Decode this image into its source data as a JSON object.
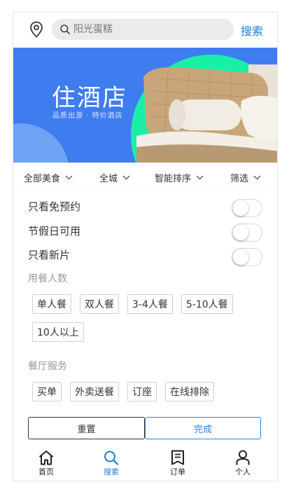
{
  "header": {
    "location_icon": "location-pin-icon",
    "search_placeholder": "阳光蛋糕",
    "search_button": "搜索"
  },
  "banner": {
    "title": "住酒店",
    "subtitle": "品质出游 · 特价酒店",
    "colors": {
      "background": "#3f7cf0",
      "accent": "#19f0a6"
    }
  },
  "filters": [
    {
      "label": "全部美食"
    },
    {
      "label": "全城"
    },
    {
      "label": "智能排序"
    },
    {
      "label": "筛选"
    }
  ],
  "panel": {
    "toggles": [
      {
        "label": "只看免预约",
        "on": false
      },
      {
        "label": "节假日可用",
        "on": false
      },
      {
        "label": "只看新片",
        "on": false
      }
    ],
    "diners_title": "用餐人数",
    "diners": [
      "单人餐",
      "双人餐",
      "3-4人餐",
      "5-10人餐",
      "10人以上"
    ],
    "services_title": "餐厅服务",
    "services": [
      "买单",
      "外卖送餐",
      "订座",
      "在线排除"
    ],
    "reset_label": "重置",
    "done_label": "完成"
  },
  "tabbar": {
    "items": [
      {
        "label": "首页",
        "icon": "home-icon"
      },
      {
        "label": "搜索",
        "icon": "search-icon",
        "active": true
      },
      {
        "label": "订单",
        "icon": "order-icon"
      },
      {
        "label": "个人",
        "icon": "profile-icon"
      }
    ],
    "active_color": "#1a7fd6"
  }
}
